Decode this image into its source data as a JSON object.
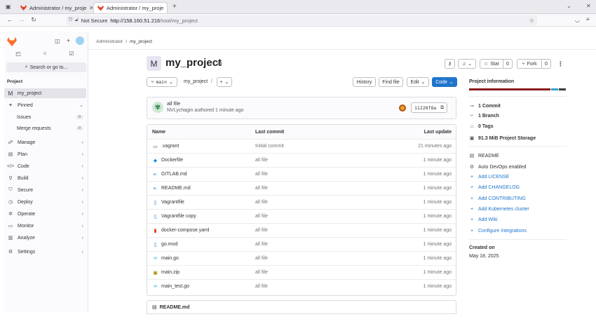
{
  "browser": {
    "tabs": [
      {
        "title": "Administrator / my_proje"
      },
      {
        "title": "Administrator / my_proje"
      }
    ],
    "address": {
      "security": "Not Secure",
      "url_host": "http://158.160.51.216",
      "url_path": "/root/my_project"
    }
  },
  "sidebar": {
    "search_label": "Search or go to...",
    "section": "Project",
    "project_initial": "M",
    "project_name": "my_project",
    "items": [
      {
        "label": "Pinned"
      },
      {
        "label": "Issues",
        "count": "0"
      },
      {
        "label": "Merge requests",
        "count": "0"
      },
      {
        "label": "Manage"
      },
      {
        "label": "Plan"
      },
      {
        "label": "Code"
      },
      {
        "label": "Build"
      },
      {
        "label": "Secure"
      },
      {
        "label": "Deploy"
      },
      {
        "label": "Operate"
      },
      {
        "label": "Monitor"
      },
      {
        "label": "Analyze"
      },
      {
        "label": "Settings"
      }
    ]
  },
  "breadcrumb": {
    "root": "Administrator",
    "sep": "/",
    "current": "my_project"
  },
  "project": {
    "initial": "M",
    "title": "my_project",
    "star_label": "Star",
    "star_count": "0",
    "fork_label": "Fork",
    "fork_count": "0"
  },
  "toolbar": {
    "branch": "main",
    "path": "my_project",
    "path_sep": "/",
    "add": "+",
    "history": "History",
    "find_file": "Find file",
    "edit": "Edit",
    "code": "Code"
  },
  "commit": {
    "title": "all file",
    "author_line": "NVLychagin authored 1 minute ago",
    "sha": "11228f8a"
  },
  "files": {
    "headers": {
      "name": "Name",
      "last_commit": "Last commit",
      "last_update": "Last update"
    },
    "rows": [
      {
        "name": ".vagrant",
        "commit": "Initial commit",
        "updated": "21 minutes ago",
        "icon": "folder-icon"
      },
      {
        "name": "Dockerfile",
        "commit": "all file",
        "updated": "1 minute ago",
        "icon": "docker-icon"
      },
      {
        "name": "GITLAB.md",
        "commit": "all file",
        "updated": "1 minute ago",
        "icon": "markdown-icon"
      },
      {
        "name": "README.md",
        "commit": "all file",
        "updated": "1 minute ago",
        "icon": "markdown-icon"
      },
      {
        "name": "Vagrantfile",
        "commit": "all file",
        "updated": "1 minute ago",
        "icon": "file-icon"
      },
      {
        "name": "Vagrantfile copy",
        "commit": "all file",
        "updated": "1 minute ago",
        "icon": "file-icon"
      },
      {
        "name": "docker-compose.yaml",
        "commit": "all file",
        "updated": "1 minute ago",
        "icon": "yaml-icon"
      },
      {
        "name": "go.mod",
        "commit": "all file",
        "updated": "1 minute ago",
        "icon": "file-icon"
      },
      {
        "name": "main.go",
        "commit": "all file",
        "updated": "1 minute ago",
        "icon": "go-icon"
      },
      {
        "name": "main.zip",
        "commit": "all file",
        "updated": "1 minute ago",
        "icon": "zip-icon"
      },
      {
        "name": "main_test.go",
        "commit": "all file",
        "updated": "1 minute ago",
        "icon": "go-icon"
      }
    ]
  },
  "readme_title": "README.md",
  "info": {
    "title": "Project information",
    "language_colors": [
      "#8b1a1a",
      "#2fa6c9",
      "#3b3b3b"
    ],
    "language_share": [
      0.85,
      0.08,
      0.07
    ],
    "commits": "1 Commit",
    "branches": "1 Branch",
    "tags": "0 Tags",
    "storage": "91.3 MiB Project Storage",
    "readme": "README",
    "autodevops": "Auto DevOps enabled",
    "links": [
      "Add LICENSE",
      "Add CHANGELOG",
      "Add CONTRIBUTING",
      "Add Kubernetes cluster",
      "Add Wiki",
      "Configure Integrations"
    ],
    "created_label": "Created on",
    "created_date": "May 18, 2025"
  },
  "colors": {
    "accent": "#1f75cb",
    "brand": "#fc6d26"
  }
}
